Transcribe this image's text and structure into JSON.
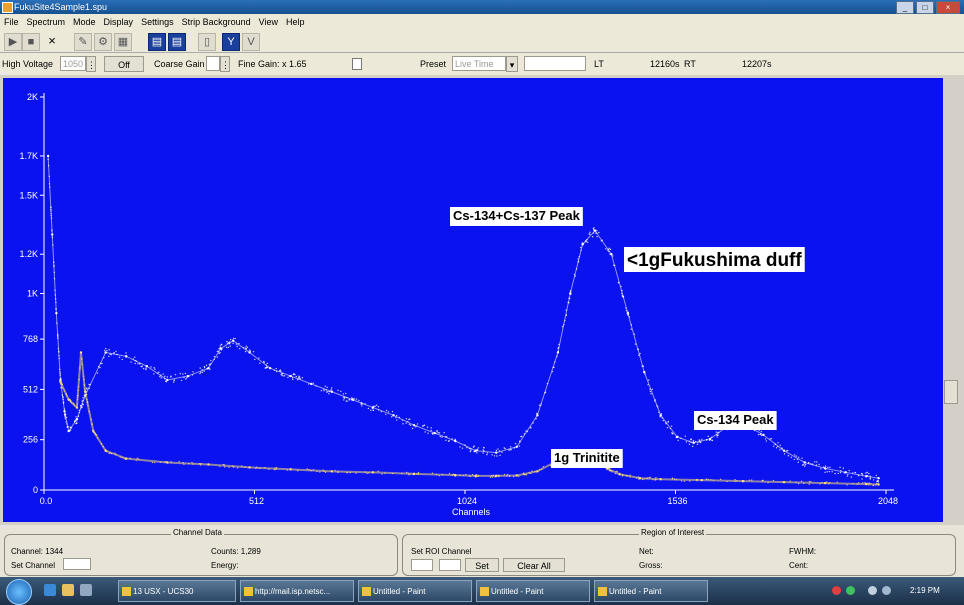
{
  "window": {
    "title": "FukuSite4Sample1.spu",
    "min": "_",
    "max": "□",
    "close": "×"
  },
  "menu": [
    "File",
    "Spectrum",
    "Mode",
    "Display",
    "Settings",
    "Strip Background",
    "View",
    "Help"
  ],
  "toolbar": {
    "x_label": "×",
    "active1": "▤",
    "active2": "▤",
    "y_scale": "Y"
  },
  "controls": {
    "hv_label": "High Voltage",
    "hv_value": "1050",
    "off_label": "Off",
    "coarse_label": "Coarse Gain",
    "fine_label": "Fine Gain: x 1.65",
    "preset_label": "Preset",
    "preset_value": "Live Time",
    "lt_label": "LT",
    "lt_value": "12160s",
    "rt_label": "RT",
    "rt_value": "12207s"
  },
  "chart_data": {
    "type": "scatter",
    "title": "",
    "xlabel": "Channels",
    "ylabel": "",
    "xlim": [
      0,
      2048
    ],
    "ylim": [
      0,
      2000
    ],
    "x_ticks": [
      "0.0",
      "512",
      "1024",
      "1536",
      "2048"
    ],
    "y_ticks": [
      "0",
      "256",
      "512",
      "768",
      "1K",
      "1.2K",
      "1.5K",
      "1.7K",
      "2K"
    ],
    "background": "#0a12f0",
    "series": [
      {
        "name": "<1gFukushima duff",
        "color": "#ffffff",
        "x": [
          10,
          20,
          30,
          40,
          50,
          60,
          80,
          100,
          150,
          200,
          250,
          300,
          350,
          400,
          430,
          460,
          500,
          550,
          600,
          650,
          700,
          750,
          800,
          850,
          900,
          950,
          1000,
          1050,
          1100,
          1150,
          1200,
          1250,
          1280,
          1310,
          1340,
          1380,
          1420,
          1460,
          1500,
          1540,
          1580,
          1620,
          1660,
          1700,
          1750,
          1800,
          1850,
          1900,
          1950,
          2000,
          2030
        ],
        "y": [
          1700,
          1300,
          900,
          560,
          400,
          300,
          360,
          480,
          700,
          680,
          630,
          560,
          580,
          620,
          720,
          760,
          700,
          620,
          580,
          540,
          500,
          460,
          420,
          380,
          330,
          290,
          250,
          200,
          190,
          220,
          380,
          700,
          1000,
          1250,
          1320,
          1200,
          900,
          600,
          380,
          270,
          240,
          260,
          320,
          340,
          280,
          200,
          140,
          110,
          90,
          70,
          60
        ]
      },
      {
        "name": "1g Trinitite",
        "color": "#ffe070",
        "x": [
          40,
          60,
          80,
          90,
          100,
          120,
          150,
          200,
          300,
          400,
          500,
          600,
          700,
          800,
          900,
          1000,
          1050,
          1100,
          1150,
          1200,
          1250,
          1280,
          1310,
          1340,
          1370,
          1400,
          1450,
          1500,
          1600,
          1700,
          1800,
          1900,
          2000,
          2030
        ],
        "y": [
          550,
          460,
          420,
          700,
          500,
          300,
          200,
          160,
          140,
          130,
          115,
          105,
          95,
          90,
          82,
          76,
          72,
          72,
          74,
          95,
          150,
          180,
          175,
          150,
          110,
          80,
          60,
          55,
          50,
          45,
          40,
          35,
          30,
          28
        ]
      }
    ],
    "annotations": [
      {
        "text": "Cs-134+Cs-137 Peak"
      },
      {
        "text": "<1gFukushima duff"
      },
      {
        "text": "Cs-134 Peak"
      },
      {
        "text": "1g Trinitite"
      }
    ]
  },
  "status": {
    "channel_data_title": "Channel Data",
    "channel_label": "Channel: 1344",
    "counts_label": "Counts: 1,289",
    "set_channel_label": "Set Channel",
    "energy_label": "Energy:",
    "roi_title": "Region of Interest",
    "set_roi_label": "Set ROI Channel",
    "set_button": "Set",
    "clear_all_button": "Clear All",
    "net_label": "Net:",
    "gross_label": "Gross:",
    "fwhm_label": "FWHM:",
    "cent_label": "Cent:"
  },
  "taskbar": {
    "tasks": [
      "13 USX - UCS30",
      "http://mail.isp.netsc...",
      "Untitled - Paint",
      "Untitled - Paint",
      "Untitled - Paint"
    ],
    "clock": "2:19 PM"
  }
}
